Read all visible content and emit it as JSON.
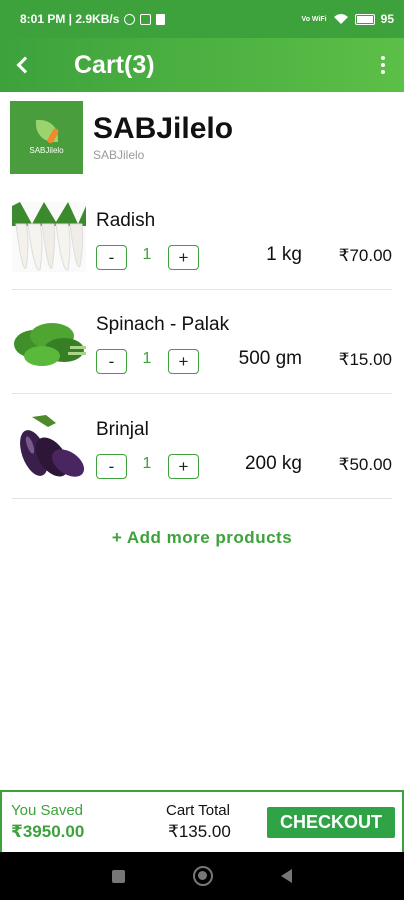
{
  "status_bar": {
    "time_speed": "8:01 PM | 2.9KB/s",
    "network": "Vo WiFi",
    "battery": "95"
  },
  "app_bar": {
    "title": "Cart(3)",
    "back_icon": "back-arrow-icon",
    "menu_icon": "more-vert-icon"
  },
  "store": {
    "name": "SABJilelo",
    "subtitle": "SABJilelo",
    "logo_text": "SABJilelo"
  },
  "items": [
    {
      "name": "Radish",
      "quantity": "1",
      "weight": "1 kg",
      "price": "₹70.00",
      "minus": "-",
      "plus": "+"
    },
    {
      "name": "Spinach - Palak",
      "quantity": "1",
      "weight": "500 gm",
      "price": "₹15.00",
      "minus": "-",
      "plus": "+"
    },
    {
      "name": "Brinjal",
      "quantity": "1",
      "weight": "200 kg",
      "price": "₹50.00",
      "minus": "-",
      "plus": "+"
    }
  ],
  "add_more_label": "+ Add more products",
  "footer": {
    "saved_label": "You Saved",
    "saved_value": "₹3950.00",
    "total_label": "Cart Total",
    "total_value": "₹135.00",
    "checkout_label": "CHECKOUT"
  },
  "colors": {
    "brand_green": "#3da23c",
    "checkout_green": "#2fa346"
  }
}
